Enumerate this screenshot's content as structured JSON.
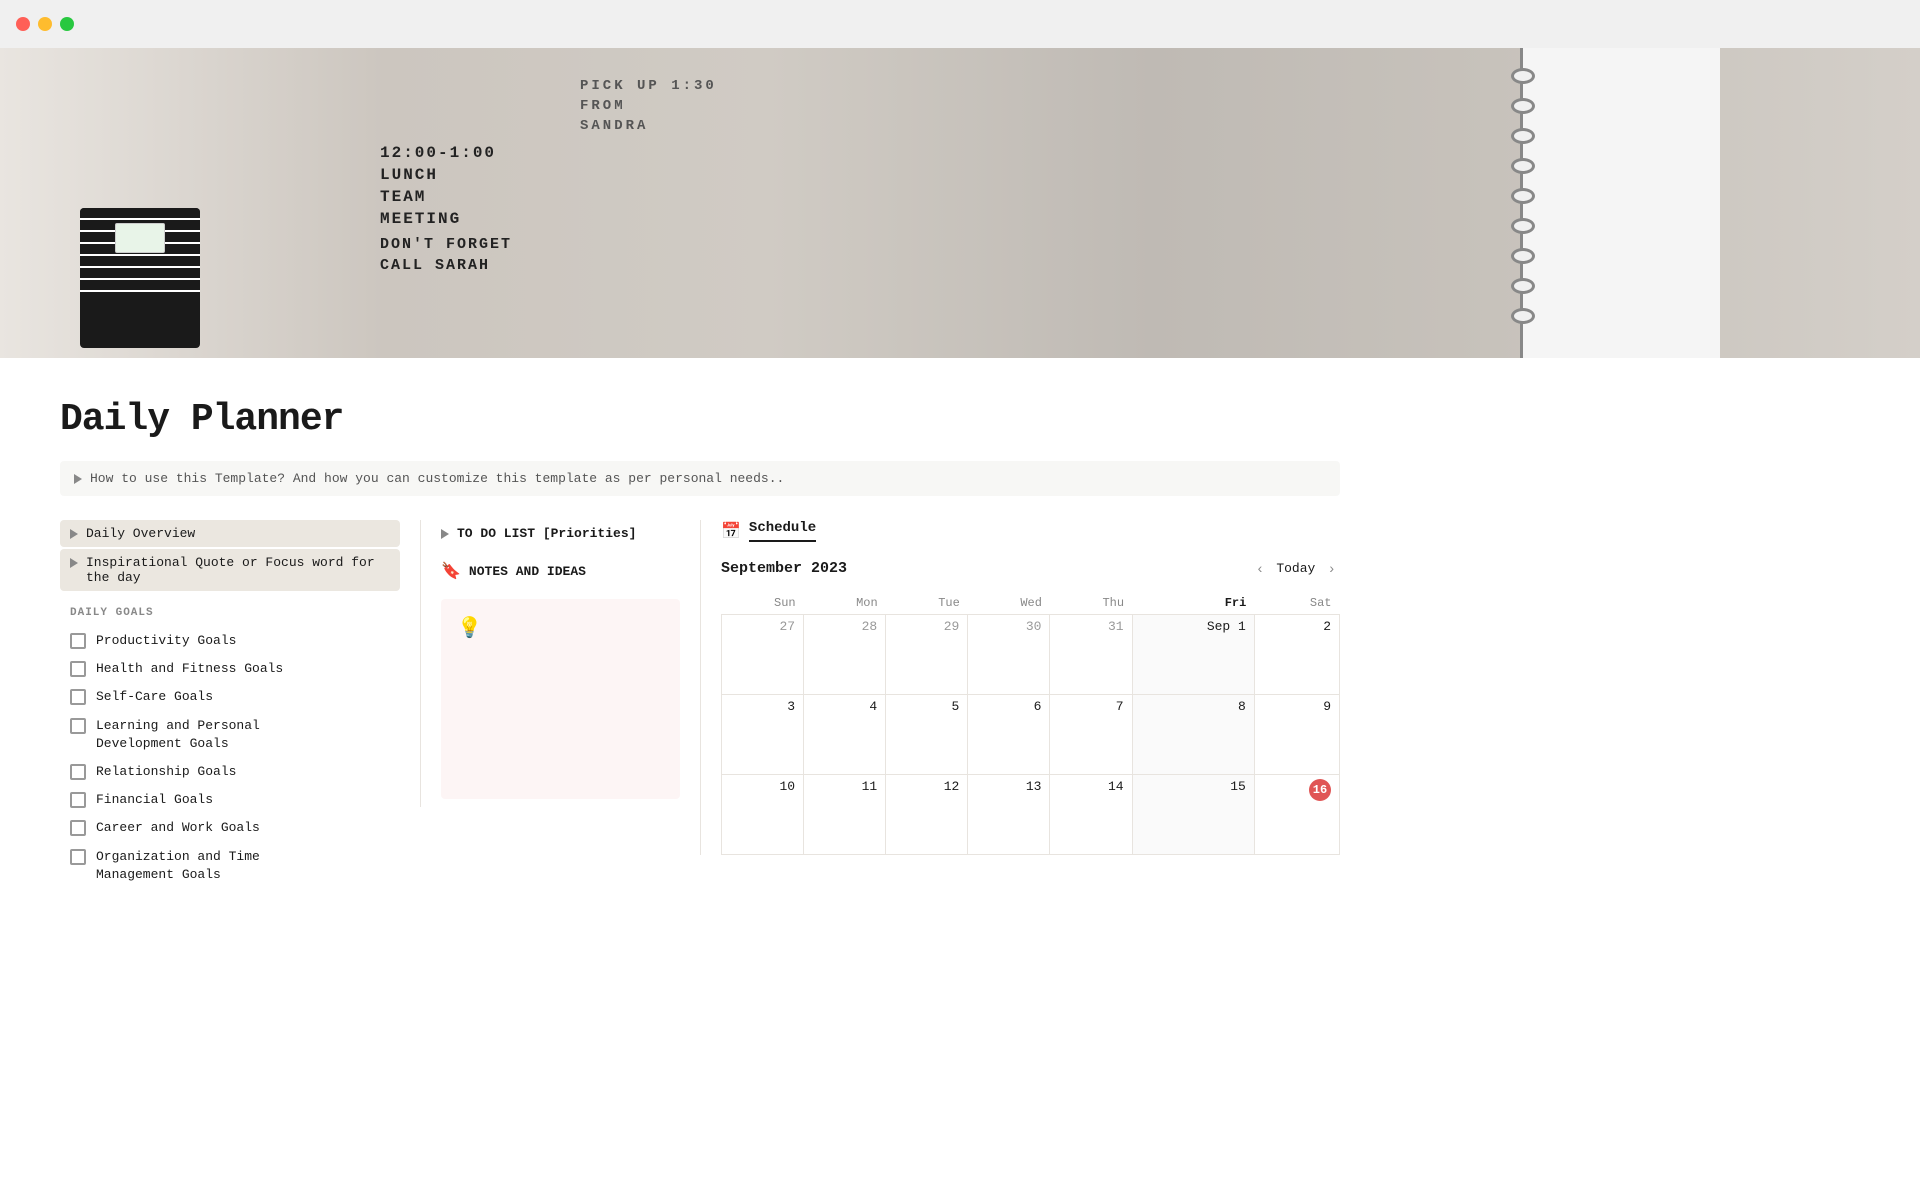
{
  "titlebar": {
    "traffic_red": "close",
    "traffic_yellow": "minimize",
    "traffic_green": "maximize"
  },
  "page": {
    "title": "Daily Planner",
    "hint": "How to use this Template? And how you can customize this template as per personal needs.."
  },
  "left_col": {
    "toggle_items": [
      {
        "label": "Daily Overview"
      },
      {
        "label": "Inspirational Quote or Focus word for the day"
      }
    ],
    "section_header": "DAILY GOALS",
    "goals": [
      {
        "label": "Productivity Goals",
        "checked": false
      },
      {
        "label": "Health and Fitness Goals",
        "checked": false
      },
      {
        "label": "Self-Care Goals",
        "checked": false
      },
      {
        "label": "Learning and Personal Development Goals",
        "checked": false
      },
      {
        "label": "Relationship Goals",
        "checked": false
      },
      {
        "label": "Financial Goals",
        "checked": false
      },
      {
        "label": "Career and Work Goals",
        "checked": false
      },
      {
        "label": "Organization and Time Management Goals",
        "checked": false
      }
    ]
  },
  "mid_col": {
    "todo_label": "TO DO LIST [Priorities]",
    "notes_label": "NOTES AND IDEAS"
  },
  "calendar": {
    "tab_label": "Schedule",
    "month": "September 2023",
    "today_label": "Today",
    "days": [
      "Sun",
      "Mon",
      "Tue",
      "Wed",
      "Thu",
      "Fri",
      "Sat"
    ],
    "weeks": [
      [
        {
          "num": "27",
          "current": false
        },
        {
          "num": "28",
          "current": false
        },
        {
          "num": "29",
          "current": false
        },
        {
          "num": "30",
          "current": false
        },
        {
          "num": "31",
          "current": false
        },
        {
          "num": "Sep 1",
          "current": true,
          "is_sep1": true
        },
        {
          "num": "2",
          "current": true
        }
      ],
      [
        {
          "num": "3",
          "current": true
        },
        {
          "num": "4",
          "current": true
        },
        {
          "num": "5",
          "current": true
        },
        {
          "num": "6",
          "current": true
        },
        {
          "num": "7",
          "current": true
        },
        {
          "num": "8",
          "current": true
        },
        {
          "num": "9",
          "current": true
        }
      ],
      [
        {
          "num": "10",
          "current": true
        },
        {
          "num": "11",
          "current": true
        },
        {
          "num": "12",
          "current": true
        },
        {
          "num": "13",
          "current": true
        },
        {
          "num": "14",
          "current": true
        },
        {
          "num": "15",
          "current": true
        },
        {
          "num": "16",
          "current": true,
          "today": true
        }
      ]
    ]
  }
}
